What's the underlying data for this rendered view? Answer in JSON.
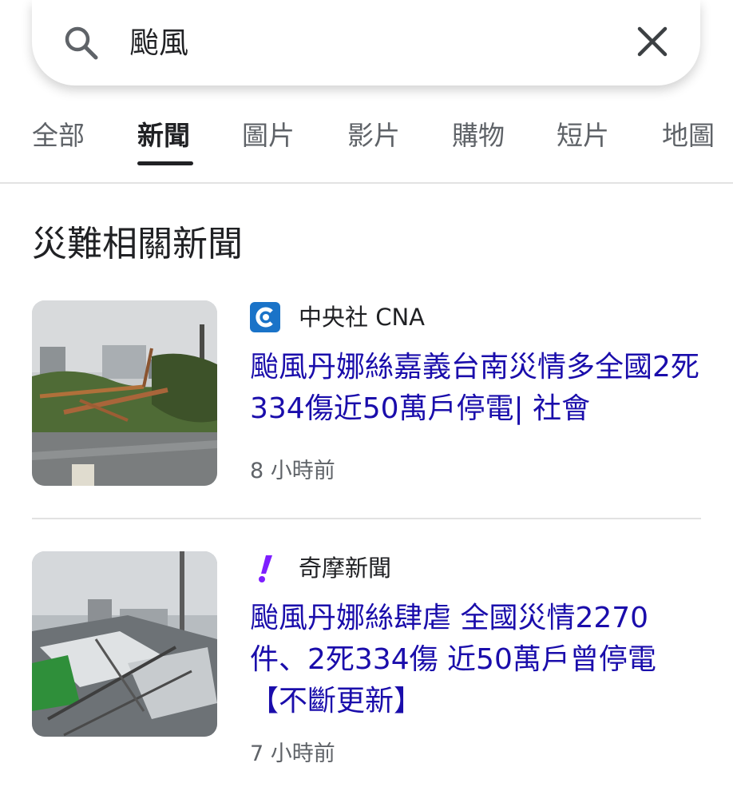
{
  "search": {
    "query": "颱風"
  },
  "tabs": [
    {
      "label": "全部",
      "active": false
    },
    {
      "label": "新聞",
      "active": true
    },
    {
      "label": "圖片",
      "active": false
    },
    {
      "label": "影片",
      "active": false
    },
    {
      "label": "購物",
      "active": false
    },
    {
      "label": "短片",
      "active": false
    },
    {
      "label": "地圖",
      "active": false
    }
  ],
  "section": {
    "title": "災難相關新聞"
  },
  "articles": [
    {
      "source": "中央社 CNA",
      "source_icon": "cna-logo-icon",
      "headline": "颱風丹娜絲嘉義台南災情多全國2死334傷近50萬戶停電| 社會",
      "time": "8 小時前",
      "thumbnail": "fallen-tree-photo"
    },
    {
      "source": "奇摩新聞",
      "source_icon": "yahoo-exclamation-icon",
      "headline": "颱風丹娜絲肆虐 全國災情2270件、2死334傷 近50萬戶曾停電【不斷更新】",
      "time": "7 小時前",
      "thumbnail": "collapsed-structure-photo"
    }
  ],
  "colors": {
    "link": "#1a0dab",
    "muted": "#5f6368",
    "cna_blue": "#1a73c8",
    "yahoo_purple": "#7e1fff"
  }
}
